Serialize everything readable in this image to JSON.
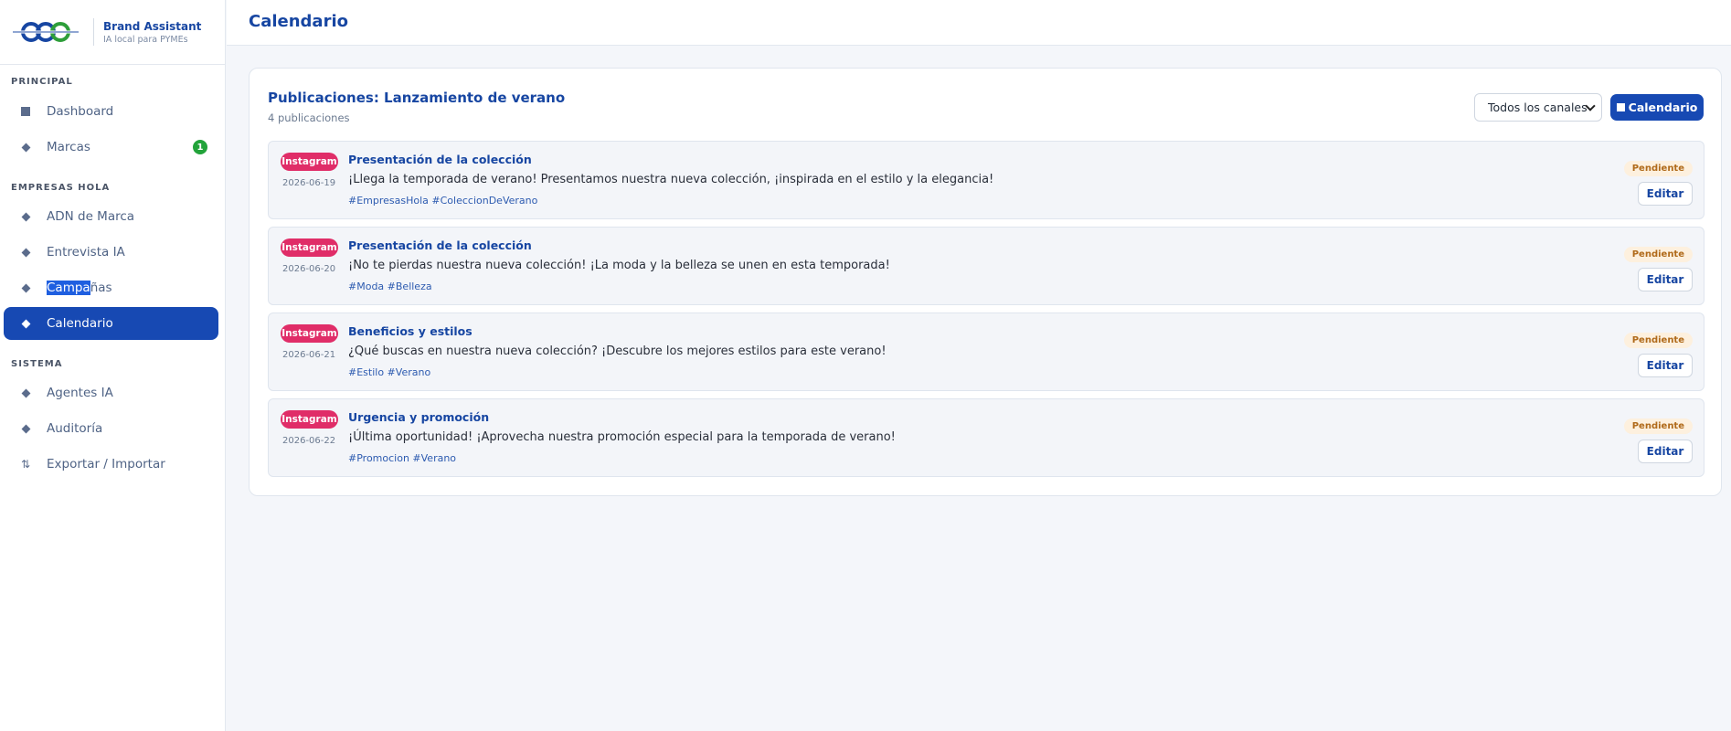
{
  "brand": {
    "logo_icon": "ccc-logo-icon",
    "name": "Brand Assistant",
    "tagline": "IA local para PYMEs"
  },
  "sidebar": {
    "sections": [
      {
        "title": "PRINCIPAL"
      },
      {
        "title": "EMPRESAS HOLA"
      },
      {
        "title": "SISTEMA"
      }
    ],
    "items": [
      {
        "label": "Dashboard",
        "icon": "square-icon"
      },
      {
        "label": "Marcas",
        "icon": "diamond-icon",
        "badge": "1"
      },
      {
        "label": "ADN de Marca",
        "icon": "diamond-icon"
      },
      {
        "label": "Entrevista IA",
        "icon": "diamond-icon"
      },
      {
        "label_selected": "Campa",
        "label_rest": "ñas",
        "icon": "diamond-icon"
      },
      {
        "label": "Calendario",
        "icon": "diamond-icon",
        "active": true
      },
      {
        "label": "Agentes IA",
        "icon": "diamond-icon"
      },
      {
        "label": "Auditoría",
        "icon": "diamond-icon"
      },
      {
        "label": "Exportar / Importar",
        "icon": "sort-arrows-icon"
      }
    ]
  },
  "header": {
    "title": "Calendario"
  },
  "main": {
    "title": "Publicaciones: Lanzamiento de verano",
    "count": "4 publicaciones",
    "channel_filter": "Todos los canales",
    "calendar_button": "Calendario",
    "posts": [
      {
        "channel": "Instagram",
        "date": "2026-06-19",
        "title": "Presentación de la colección",
        "text": "¡Llega la temporada de verano! Presentamos nuestra nueva colección, ¡inspirada en el estilo y la elegancia!",
        "tags": "#EmpresasHola #ColeccionDeVerano",
        "status": "Pendiente",
        "edit": "Editar"
      },
      {
        "channel": "Instagram",
        "date": "2026-06-20",
        "title": "Presentación de la colección",
        "text": "¡No te pierdas nuestra nueva colección! ¡La moda y la belleza se unen en esta temporada!",
        "tags": "#Moda #Belleza",
        "status": "Pendiente",
        "edit": "Editar"
      },
      {
        "channel": "Instagram",
        "date": "2026-06-21",
        "title": "Beneficios y estilos",
        "text": "¿Qué buscas en nuestra nueva colección? ¡Descubre los mejores estilos para este verano!",
        "tags": "#Estilo #Verano",
        "status": "Pendiente",
        "edit": "Editar"
      },
      {
        "channel": "Instagram",
        "date": "2026-06-22",
        "title": "Urgencia y promoción",
        "text": "¡Última oportunidad! ¡Aprovecha nuestra promoción especial para la temporada de verano!",
        "tags": "#Promocion #Verano",
        "status": "Pendiente",
        "edit": "Editar"
      }
    ]
  },
  "colors": {
    "primary": "#1749b3",
    "instagram": "#e02d68",
    "pending_bg": "#fdf0de",
    "pending_text": "#b06a1a",
    "badge_green": "#22a33a"
  }
}
